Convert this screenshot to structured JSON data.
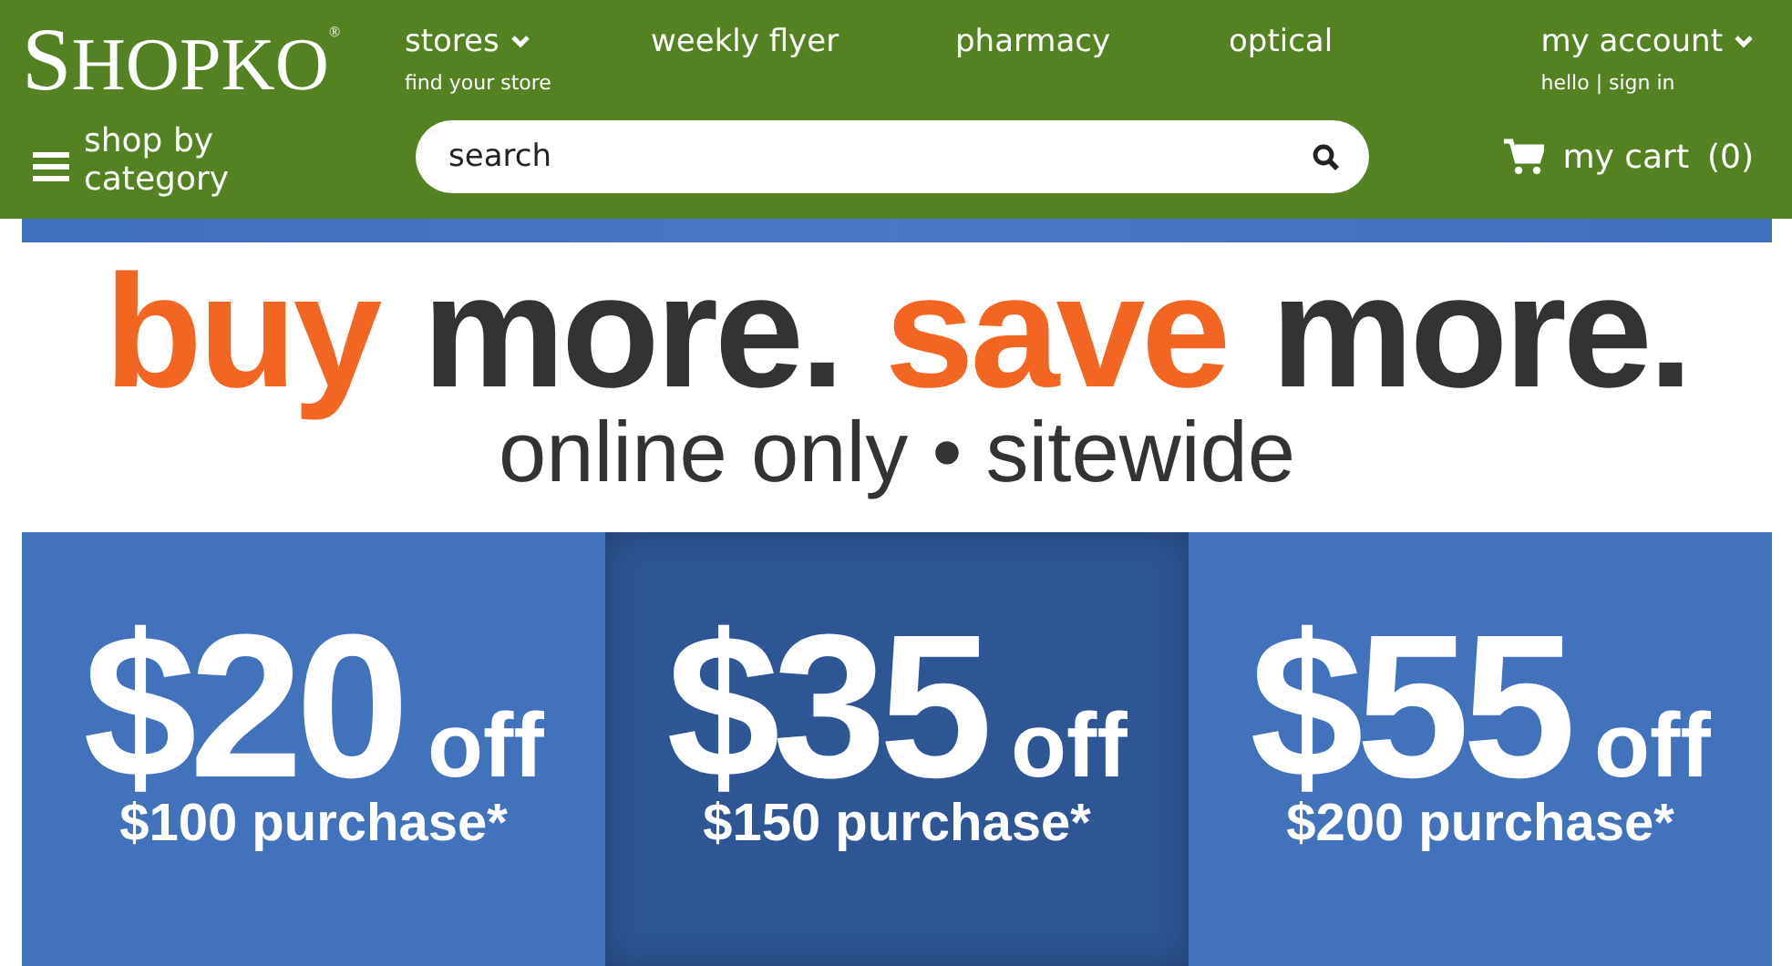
{
  "header": {
    "logo": "SHOPKO$^{®}$",
    "nav": [
      {
        "label": "stores",
        "caption": "find your store",
        "dropdown": true
      },
      {
        "label": "weekly flyer",
        "dropdown": false
      },
      {
        "label": "pharmacy",
        "dropdown": false
      },
      {
        "label": "optical",
        "dropdown": false
      }
    ],
    "account": {
      "label": "my account",
      "caption": "hello | sign in",
      "dropdown": true
    },
    "category_menu": "shop by category",
    "search": {
      "placeholder": "search"
    },
    "cart": {
      "label": "my cart",
      "count": "(0)"
    }
  },
  "banner": {
    "headline": [
      {
        "text": "buy",
        "color": "#f26522"
      },
      {
        "text": "more.",
        "color": "#333333"
      },
      {
        "text": "save",
        "color": "#f26522"
      },
      {
        "text": "more.",
        "color": "#333333"
      }
    ],
    "subline": "online only • sitewide"
  },
  "offers": [
    {
      "amount": "$20",
      "suffix": "off",
      "condition": "$100 purchase*",
      "selected": false
    },
    {
      "amount": "$35",
      "suffix": "off",
      "condition": "$150 purchase*",
      "selected": true
    },
    {
      "amount": "$55",
      "suffix": "off",
      "condition": "$200 purchase*",
      "selected": false
    }
  ]
}
